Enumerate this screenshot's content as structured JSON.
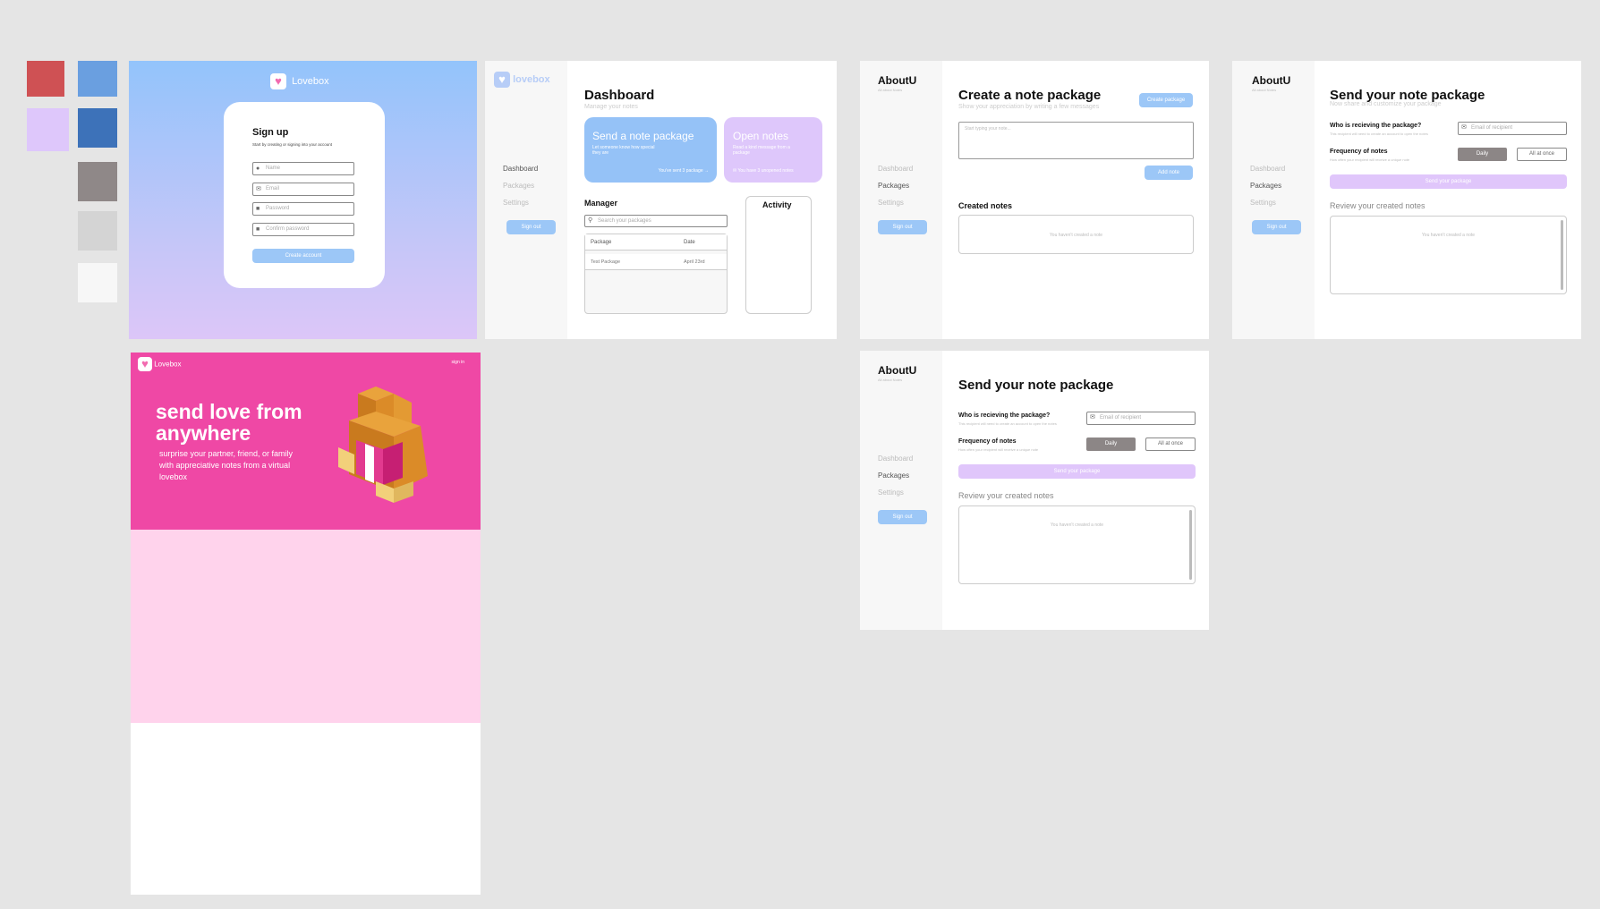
{
  "palette": {
    "colors": [
      "#cf5154",
      "#6a9fe0",
      "#dec7fb",
      "#3d72b9",
      "#8f8888",
      "#d4d4d4",
      "#f7f7f7"
    ]
  },
  "signup": {
    "brand": "Lovebox",
    "title": "Sign up",
    "subtitle": "Start by creating or signing into your account",
    "fields": [
      {
        "placeholder": "Name",
        "icon": "user-icon"
      },
      {
        "placeholder": "Email",
        "icon": "mail-icon"
      },
      {
        "placeholder": "Password",
        "icon": "lock-icon"
      },
      {
        "placeholder": "Confirm password",
        "icon": "lock-icon"
      }
    ],
    "cta": "Create account"
  },
  "dashboard": {
    "brand": "lovebox",
    "title": "Dashboard",
    "subtitle": "Manage your notes",
    "nav": [
      "Dashboard",
      "Packages",
      "Settings"
    ],
    "signout": "Sign out",
    "card_send": {
      "title": "Send a note package",
      "desc": "Let someone know how special they are",
      "footer": "You've sent 3 package →"
    },
    "card_open": {
      "title": "Open notes",
      "desc": "Read a kind message from a package",
      "footer": "You have 3 unopened notes"
    },
    "manager": {
      "title": "Manager",
      "search_placeholder": "Search your packages",
      "columns": [
        "Package",
        "Date"
      ],
      "rows": [
        [
          "Test Package",
          "April 23rd"
        ]
      ]
    },
    "activity_title": "Activity"
  },
  "create": {
    "brand": "AboutU",
    "brand_sub": "All about Notes",
    "nav": [
      "Dashboard",
      "Packages",
      "Settings"
    ],
    "signout": "Sign out",
    "title": "Create a note package",
    "subtitle": "Show your appreciation by writing a few messages",
    "create_btn": "Create package",
    "textarea_placeholder": "Start typing your note...",
    "add_btn": "Add note",
    "created_title": "Created notes",
    "empty": "You haven't created a note"
  },
  "send": {
    "brand": "AboutU",
    "brand_sub": "All about Notes",
    "nav": [
      "Dashboard",
      "Packages",
      "Settings"
    ],
    "signout": "Sign out",
    "title": "Send your note package",
    "subtitle": "Now share and customize your package",
    "recipient_label": "Who is recieving the package?",
    "recipient_hint": "This recipient will need to create an account to open the notes",
    "recipient_placeholder": "Email of recipient",
    "freq_label": "Frequency of notes",
    "freq_hint": "How often your recipient will receive a unique note",
    "freq_daily": "Daily",
    "freq_all": "All at once",
    "send_btn": "Send your package",
    "review_title": "Review your created notes",
    "empty": "You haven't created a note"
  },
  "landing": {
    "brand": "Lovebox",
    "signin": "sign in",
    "headline": "send love from anywhere",
    "body": "surprise your partner, friend, or family with appreciative notes from a virtual lovebox"
  }
}
